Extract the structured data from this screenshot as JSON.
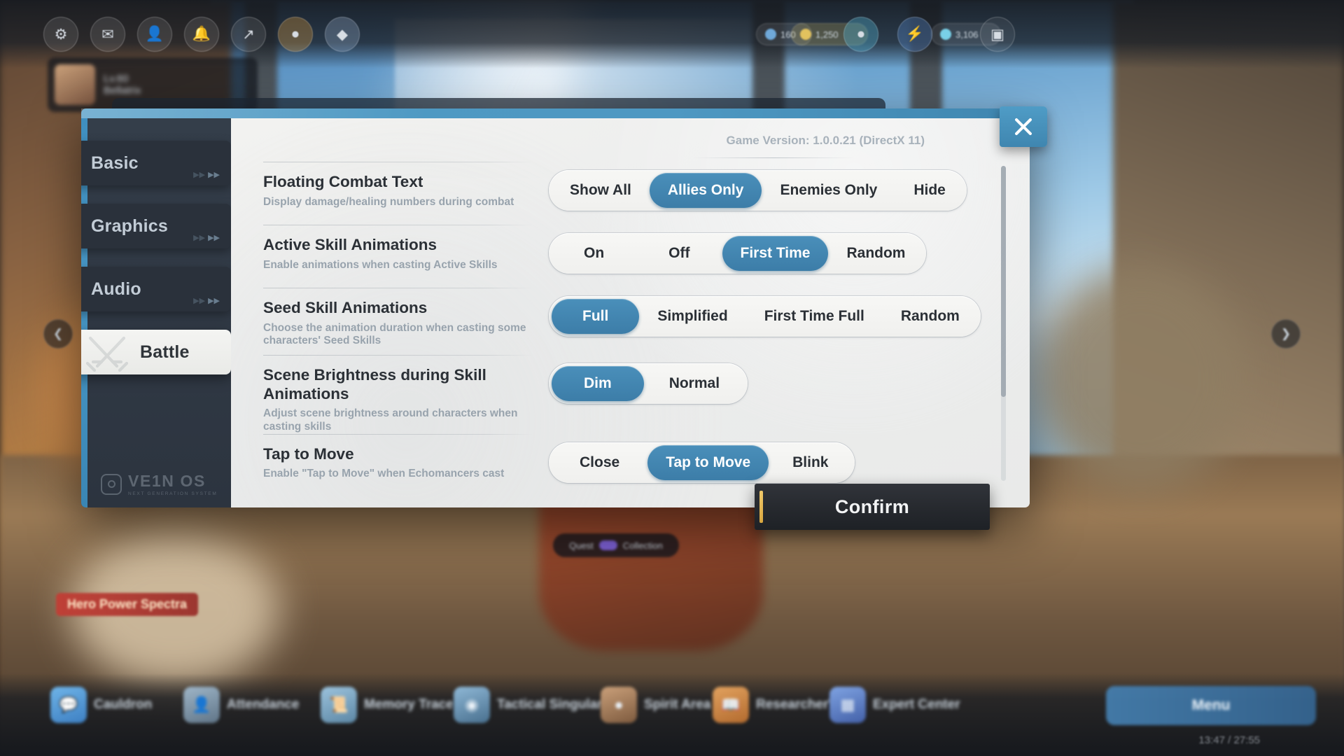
{
  "game_background": {
    "top_bar_icons": [
      "gear-icon",
      "mail-icon",
      "friends-icon",
      "bell-icon",
      "share-icon",
      "coin-icon",
      "gem-icon"
    ],
    "resources": [
      {
        "icon": "stamina-icon",
        "value": "160"
      },
      {
        "icon": "currency-icon",
        "value": "1,250"
      },
      {
        "icon": "premium-icon",
        "value": "3,106"
      }
    ],
    "character_card": {
      "name": "Lv.60",
      "subtitle": "Bellatrix"
    },
    "banner_label": "Hero Power Spectra",
    "center_pill": {
      "left": "Quest",
      "right": "Collection"
    },
    "corner_time": "13:47 / 27:55",
    "bottom_nav": [
      {
        "icon": "chat-icon",
        "label": "Cauldron"
      },
      {
        "icon": "person-icon",
        "label": "Attendance"
      },
      {
        "icon": "scroll-icon",
        "label": "Memory Trace"
      },
      {
        "icon": "target-icon",
        "label": "Tactical Singularity"
      },
      {
        "icon": "portrait-icon",
        "label": "Spirit Area"
      },
      {
        "icon": "book-icon",
        "label": "Researcher's"
      },
      {
        "icon": "grid-icon",
        "label": "Expert Center"
      }
    ],
    "menu_label": "Menu"
  },
  "modal": {
    "version_text": "Game Version: 1.0.0.21 (DirectX 11)",
    "close_icon": "close-icon",
    "confirm_label": "Confirm",
    "brand": {
      "name": "VE1N OS",
      "subtitle": "NEXT GENERATION SYSTEM"
    },
    "tabs": [
      {
        "id": "basic",
        "label": "Basic",
        "selected": false,
        "icon": null
      },
      {
        "id": "graphics",
        "label": "Graphics",
        "selected": false,
        "icon": null
      },
      {
        "id": "audio",
        "label": "Audio",
        "selected": false,
        "icon": null
      },
      {
        "id": "battle",
        "label": "Battle",
        "selected": true,
        "icon": "crossed-swords-icon"
      }
    ],
    "settings": [
      {
        "id": "floating-combat-text",
        "title": "Floating Combat Text",
        "desc": "Display damage/healing numbers during combat",
        "options": [
          "Show All",
          "Allies Only",
          "Enemies Only",
          "Hide"
        ],
        "selected": "Allies Only"
      },
      {
        "id": "active-skill-animations",
        "title": "Active Skill Animations",
        "desc": "Enable animations when casting Active Skills",
        "options": [
          "On",
          "Off",
          "First Time",
          "Random"
        ],
        "selected": "First Time"
      },
      {
        "id": "seed-skill-animations",
        "title": "Seed Skill Animations",
        "desc": "Choose the animation duration when casting some characters' Seed Skills",
        "options": [
          "Full",
          "Simplified",
          "First Time Full",
          "Random"
        ],
        "selected": "Full"
      },
      {
        "id": "scene-brightness",
        "title": "Scene Brightness during Skill Animations",
        "desc": "Adjust scene brightness around characters when casting skills",
        "options": [
          "Dim",
          "Normal"
        ],
        "selected": "Dim"
      },
      {
        "id": "tap-to-move",
        "title": "Tap to Move",
        "desc": "Enable \"Tap to Move\" when Echomancers cast",
        "options": [
          "Close",
          "Tap to Move",
          "Blink"
        ],
        "selected": "Tap to Move"
      }
    ]
  },
  "colors": {
    "accent_blue": "#3c7da8",
    "header_blue": "#4f9ac4",
    "panel_dark": "#313a46",
    "content_bg": "#eceded",
    "title_text": "#2b3036",
    "desc_text": "#98a3ad",
    "confirm_bg": "#26292e",
    "confirm_stripe": "#e0b34f"
  }
}
